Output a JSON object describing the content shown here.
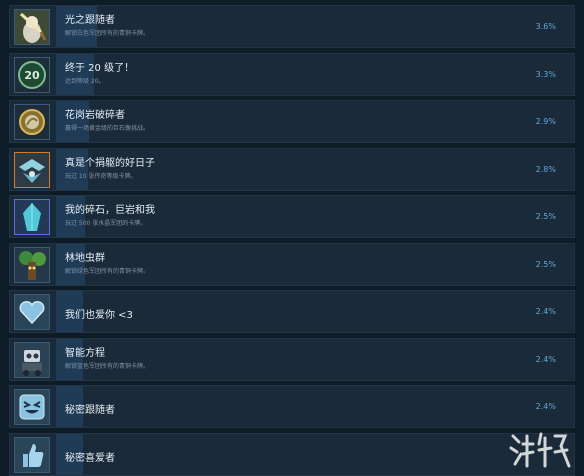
{
  "achievements": [
    {
      "title": "光之跟随者",
      "desc": "解锁白色军团所有的青铜卡牌。",
      "pct": "3.6%",
      "fill": 0.036,
      "icon": "light-follower-icon",
      "frame": "#3b5c78"
    },
    {
      "title": "终于 20 级了！",
      "desc": "达到等级 20。",
      "pct": "3.3%",
      "fill": 0.033,
      "icon": "level-20-badge-icon",
      "badge_text": "20",
      "frame": "#3b5c78"
    },
    {
      "title": "花岗岩破碎者",
      "desc": "赢得一场黄金级的巨石像挑战。",
      "pct": "2.9%",
      "fill": 0.029,
      "icon": "gold-medallion-icon",
      "frame": "#3b5c78"
    },
    {
      "title": "真是个捐躯的好日子",
      "desc": "玩过 10 张传奇等级卡牌。",
      "pct": "2.8%",
      "fill": 0.028,
      "icon": "legendary-emblem-icon",
      "frame": "#d07a2a"
    },
    {
      "title": "我的碎石，巨岩和我",
      "desc": "玩过 500 张水晶军团的卡牌。",
      "pct": "2.5%",
      "fill": 0.025,
      "icon": "blue-crystal-icon",
      "frame": "#5a6fd0"
    },
    {
      "title": "林地虫群",
      "desc": "解锁绿色军团所有的青铜卡牌。",
      "pct": "2.5%",
      "fill": 0.025,
      "icon": "treant-icon",
      "frame": "#3b5c78"
    },
    {
      "title": "我们也爱你 <3",
      "desc": "",
      "pct": "2.4%",
      "fill": 0.024,
      "icon": "heart-icon",
      "frame": "#3b5c78"
    },
    {
      "title": "智能方程",
      "desc": "解锁蓝色军团所有的青铜卡牌。",
      "pct": "2.4%",
      "fill": 0.024,
      "icon": "robot-icon",
      "frame": "#3b5c78"
    },
    {
      "title": "秘密跟随者",
      "desc": "",
      "pct": "2.4%",
      "fill": 0.024,
      "icon": "grin-face-icon",
      "frame": "#3b5c78"
    },
    {
      "title": "秘密喜爱者",
      "desc": "",
      "pct": "",
      "fill": 0.024,
      "icon": "thumbs-up-icon",
      "frame": "#3b5c78"
    }
  ],
  "colors": {
    "row_bg": "#1b2a38",
    "progress": "#1f3b56",
    "percent": "#5fa9dd",
    "title": "#e6eef5",
    "desc": "#7e93a8"
  },
  "watermark": {
    "logo": "watermark-logo-icon"
  }
}
